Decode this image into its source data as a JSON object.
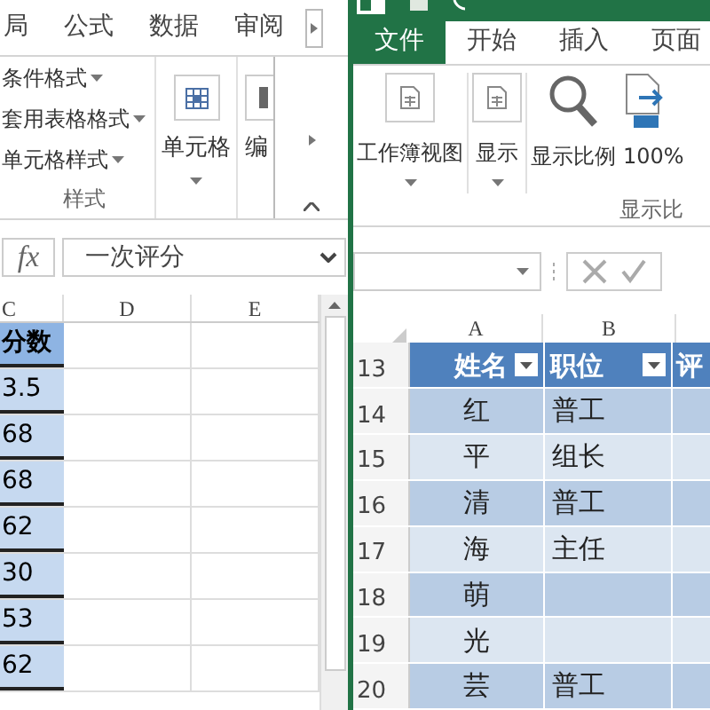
{
  "left_window": {
    "tabs": [
      {
        "label": "局"
      },
      {
        "label": "公式"
      },
      {
        "label": "数据"
      },
      {
        "label": "审阅"
      }
    ],
    "ribbon": {
      "style_items": [
        "条件格式",
        "套用表格格式",
        "单元格样式"
      ],
      "group_label": "样式",
      "buttons": [
        {
          "label": "单元格"
        },
        {
          "label": "编"
        }
      ]
    },
    "formula_bar": {
      "function_label": "fx",
      "value": "一次评分"
    },
    "columns": [
      "C",
      "D",
      "E"
    ],
    "rows": [
      {
        "kind": "header",
        "cell": "分数"
      },
      {
        "kind": "data",
        "cell": "3.5"
      },
      {
        "kind": "data",
        "cell": "68"
      },
      {
        "kind": "data",
        "cell": "68"
      },
      {
        "kind": "data",
        "cell": "62"
      },
      {
        "kind": "data",
        "cell": "30"
      },
      {
        "kind": "data",
        "cell": "53"
      },
      {
        "kind": "data",
        "cell": "62"
      }
    ]
  },
  "right_window": {
    "tabs": [
      {
        "label": "文件",
        "selected": true
      },
      {
        "label": "开始",
        "selected": false
      },
      {
        "label": "插入",
        "selected": false
      },
      {
        "label": "页面",
        "selected": false
      }
    ],
    "ribbon": {
      "buttons": [
        {
          "kind": "dropdown",
          "label": "工作簿视图"
        },
        {
          "kind": "dropdown",
          "label": "显示"
        },
        {
          "kind": "zoom",
          "label": "显示比例"
        },
        {
          "kind": "zoom100",
          "label": "100%"
        }
      ],
      "group_label": "显示比"
    },
    "columns": [
      "A",
      "B"
    ],
    "rows": [
      {
        "number": "13",
        "kind": "header",
        "name": "姓名",
        "position": "职位",
        "column_3": "评"
      },
      {
        "number": "14",
        "kind": "data",
        "name": "红",
        "position": "普工"
      },
      {
        "number": "15",
        "kind": "data",
        "name": "平",
        "position": "组长"
      },
      {
        "number": "16",
        "kind": "data",
        "name": "清",
        "position": "普工"
      },
      {
        "number": "17",
        "kind": "data",
        "name": "海",
        "position": "主任"
      },
      {
        "number": "18",
        "kind": "data",
        "name": "萌"
      },
      {
        "number": "19",
        "kind": "data",
        "name": "光"
      },
      {
        "number": "20",
        "kind": "data",
        "name": "芸",
        "position": "普工"
      }
    ]
  }
}
